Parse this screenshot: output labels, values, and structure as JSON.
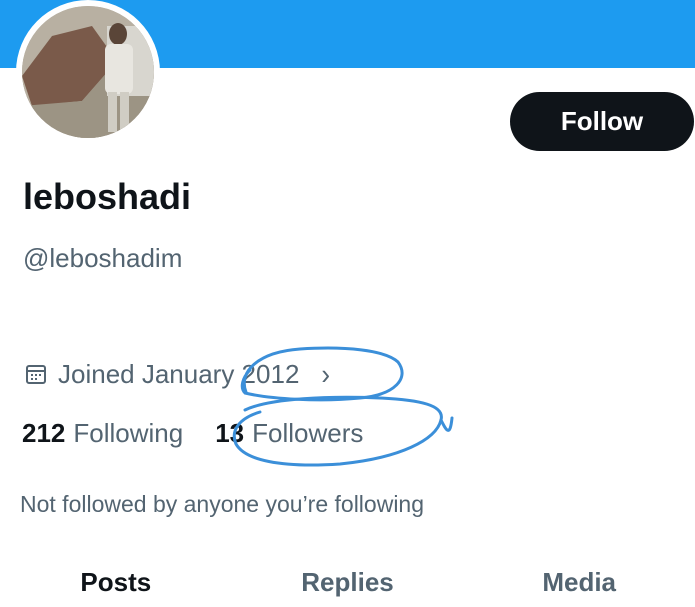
{
  "profile": {
    "display_name": "leboshadi",
    "handle": "@leboshadim",
    "follow_label": "Follow",
    "joined_text": "Joined January 2012",
    "following_count": "212",
    "following_label": "Following",
    "followers_count": "13",
    "followers_label": "Followers",
    "not_followed_text": "Not followed by anyone you’re following"
  },
  "tabs": [
    {
      "label": "Posts",
      "active": true
    },
    {
      "label": "Replies",
      "active": false
    },
    {
      "label": "Media",
      "active": false
    }
  ],
  "icons": {
    "joined": "calendar-icon",
    "joined_more": "chevron-right-icon"
  },
  "colors": {
    "banner": "#1d9bf0",
    "text_primary": "#0f1419",
    "text_secondary": "#536471",
    "annotation": "#3b8fd9"
  }
}
